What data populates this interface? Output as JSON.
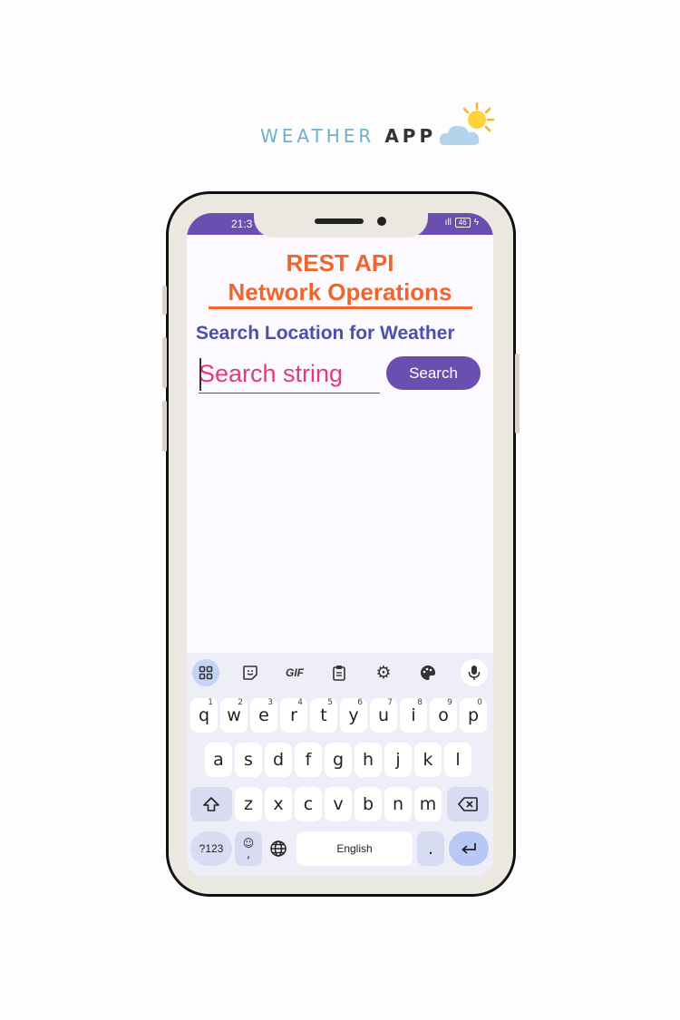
{
  "brand": {
    "word1": "WEATHER",
    "word2": "APP",
    "icon": "sun-cloud-icon"
  },
  "status": {
    "time": "21:3",
    "signal": "ıll",
    "battery": "46"
  },
  "app": {
    "title_line1": "REST API",
    "title_line2": "Network Operations",
    "subtitle": "Search Location for Weather",
    "search_placeholder": "Search string",
    "search_button": "Search"
  },
  "keyboard": {
    "toolbar": [
      "apps-grid-icon",
      "sticker-icon",
      "GIF",
      "clipboard-icon",
      "settings-icon",
      "palette-icon",
      "microphone-icon"
    ],
    "row1": [
      "q",
      "w",
      "e",
      "r",
      "t",
      "y",
      "u",
      "i",
      "o",
      "p"
    ],
    "row1_numbers": [
      "1",
      "2",
      "3",
      "4",
      "5",
      "6",
      "7",
      "8",
      "9",
      "0"
    ],
    "row2": [
      "a",
      "s",
      "d",
      "f",
      "g",
      "h",
      "j",
      "k",
      "l"
    ],
    "row3": [
      "z",
      "x",
      "c",
      "v",
      "b",
      "n",
      "m"
    ],
    "symbols_key": "?123",
    "emoji_key": "☺",
    "comma": ",",
    "space_label": "English",
    "period": ".",
    "shift_icon": "shift-icon",
    "backspace_icon": "backspace-icon",
    "globe_icon": "globe-icon",
    "enter_icon": "enter-icon"
  },
  "colors": {
    "accent": "#6a4fb0",
    "title": "#f0652e",
    "subtitle": "#4a4fb0",
    "input_text": "#e13c78"
  }
}
